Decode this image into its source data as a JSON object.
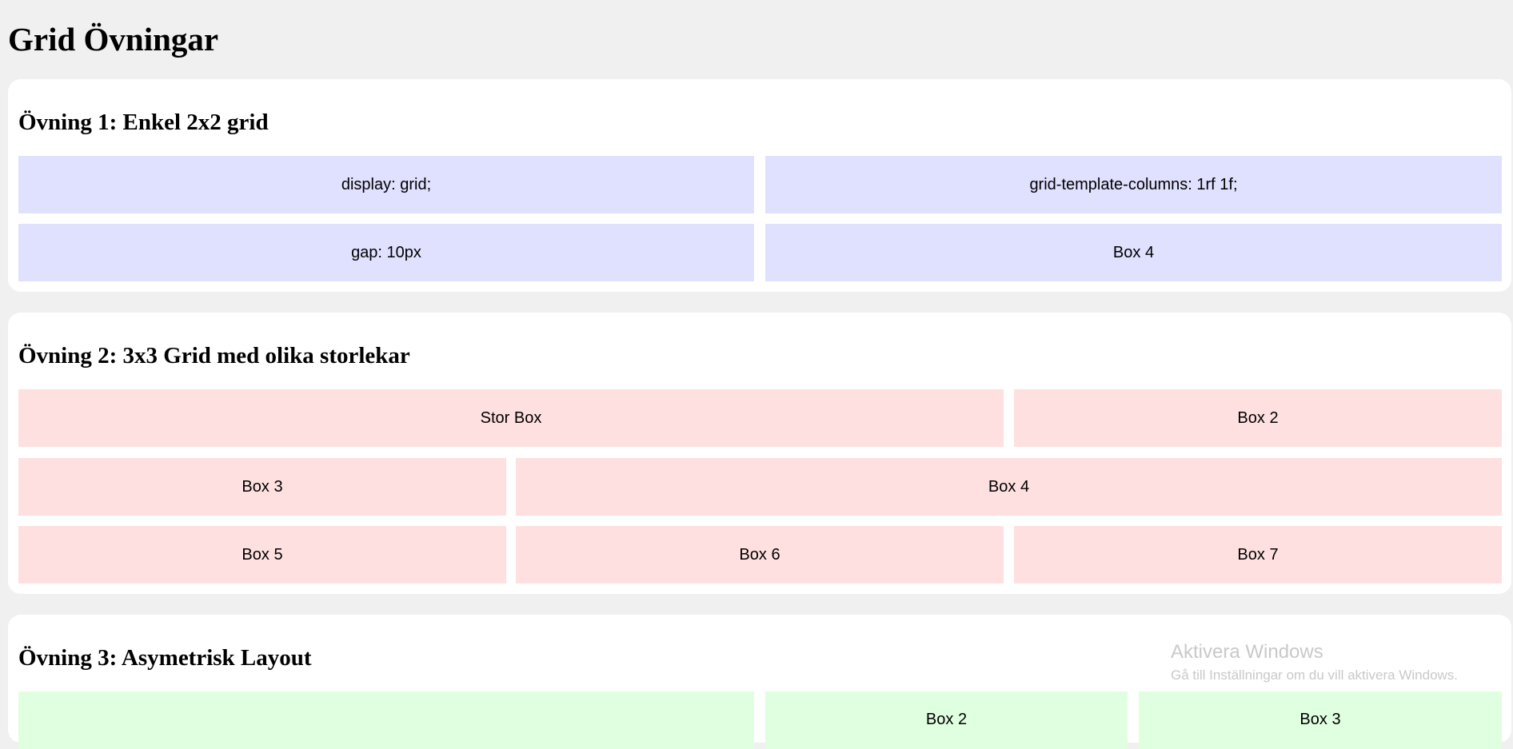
{
  "page": {
    "title": "Grid Övningar"
  },
  "exercise1": {
    "heading": "Övning 1: Enkel 2x2 grid",
    "boxes": [
      "display: grid;",
      "grid-template-columns: 1rf 1f;",
      "gap: 10px",
      "Box 4"
    ]
  },
  "exercise2": {
    "heading": "Övning 2: 3x3 Grid med olika storlekar",
    "boxes": [
      "Stor Box",
      "Box 2",
      "Box 3",
      "Box 4",
      "Box 5",
      "Box 6",
      "Box 7"
    ]
  },
  "exercise3": {
    "heading": "Övning 3: Asymetrisk Layout",
    "boxes": [
      "",
      "Box 2",
      "Box 3"
    ]
  },
  "watermark": {
    "title": "Aktivera Windows",
    "subtitle": "Gå till Inställningar om du vill aktivera Windows."
  },
  "colors": {
    "background": "#f0f0f0",
    "card": "#ffffff",
    "exercise1_box": "#e0e0ff",
    "exercise2_box": "#ffe0e0",
    "exercise3_box": "#e0ffe0"
  }
}
